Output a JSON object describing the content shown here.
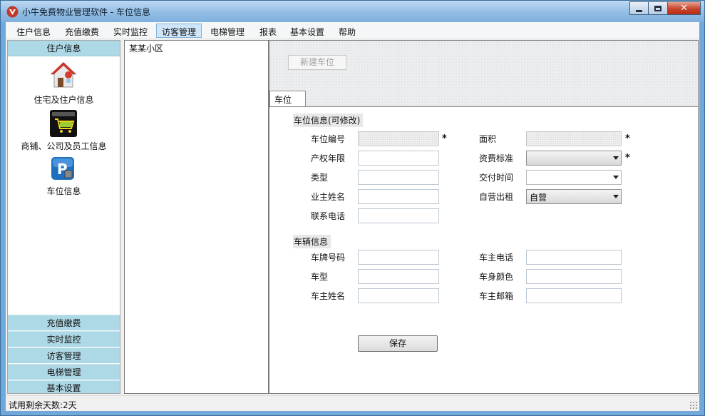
{
  "window": {
    "title": "小牛免费物业管理软件 - 车位信息"
  },
  "menu": [
    {
      "label": "住户信息",
      "active": false
    },
    {
      "label": "充值缴费",
      "active": false
    },
    {
      "label": "实时监控",
      "active": false
    },
    {
      "label": "访客管理",
      "active": true
    },
    {
      "label": "电梯管理",
      "active": false
    },
    {
      "label": "报表",
      "active": false
    },
    {
      "label": "基本设置",
      "active": false
    },
    {
      "label": "帮助",
      "active": false
    }
  ],
  "sidebar": {
    "header": "住户信息",
    "entries": [
      {
        "label": "住宅及住户信息",
        "icon": "house-icon"
      },
      {
        "label": "商铺、公司及员工信息",
        "icon": "shop-cart-icon"
      },
      {
        "label": "车位信息",
        "icon": "parking-icon"
      }
    ],
    "footer": [
      "充值缴费",
      "实时监控",
      "访客管理",
      "电梯管理",
      "基本设置"
    ]
  },
  "tree": {
    "root": "某某小区"
  },
  "toolbar": {
    "new_label": "新建车位"
  },
  "tab": {
    "label": "车位"
  },
  "form": {
    "group1_title": "车位信息(可修改)",
    "group2_title": "车辆信息",
    "labels": {
      "number": "车位编号",
      "area": "面积",
      "years": "产权年限",
      "fee": "资费标准",
      "type": "类型",
      "delivery": "交付时间",
      "owner": "业主姓名",
      "self_rent": "自营出租",
      "phone": "联系电话",
      "plate": "车牌号码",
      "car_owner_phone": "车主电话",
      "model": "车型",
      "color": "车身颜色",
      "car_owner_name": "车主姓名",
      "car_owner_email": "车主邮箱"
    },
    "values": {
      "self_rent": "自营"
    },
    "required_mark": "*",
    "save_label": "保存"
  },
  "status": {
    "text": "试用剩余天数:2天"
  },
  "colors": {
    "nav_accent": "#add8e6",
    "title_bar": "#8fbbe3"
  }
}
